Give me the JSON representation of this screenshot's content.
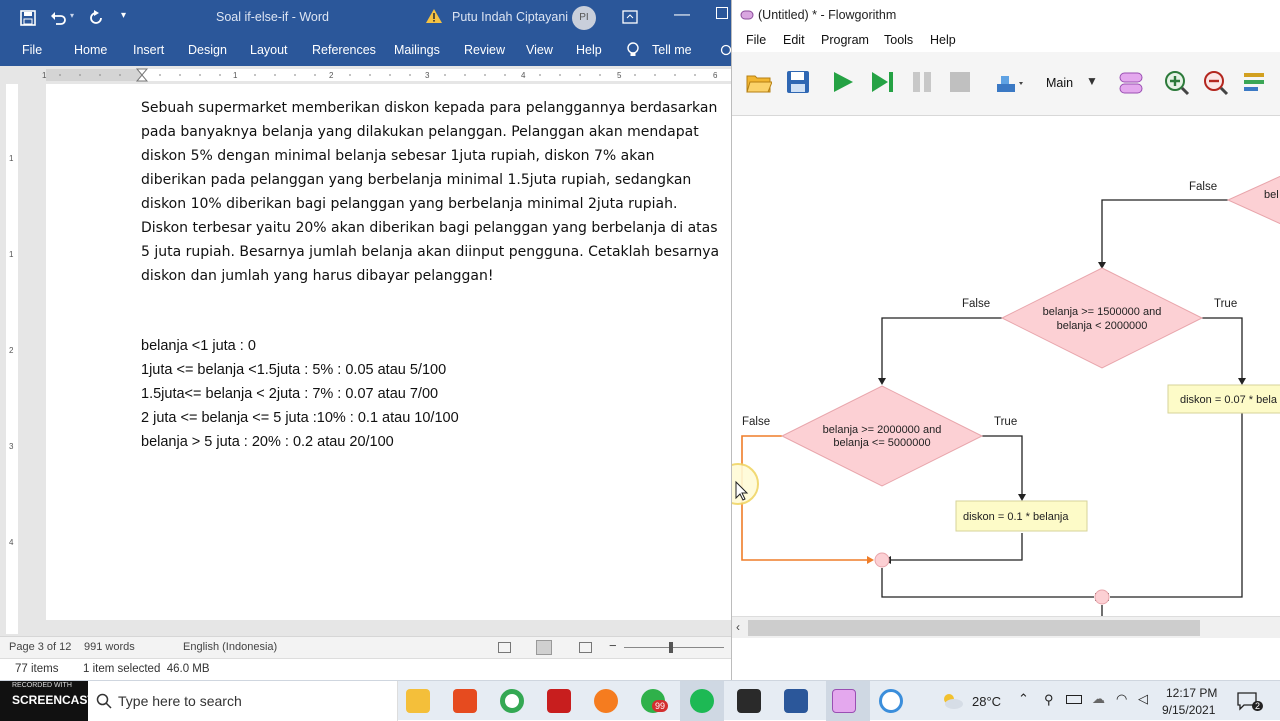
{
  "word": {
    "title": "Soal if-else-if  -  Word",
    "user": "Putu Indah Ciptayani",
    "user_initials": "PI",
    "tabs": [
      "File",
      "Home",
      "Insert",
      "Design",
      "Layout",
      "References",
      "Mailings",
      "Review",
      "View",
      "Help"
    ],
    "tell_me": "Tell me",
    "paragraph": [
      "Sebuah supermarket memberikan diskon kepada para pelanggannya berdasarkan",
      "pada banyaknya belanja yang dilakukan pelanggan. Pelanggan akan mendapat",
      "diskon 5% dengan minimal belanja sebesar 1juta rupiah, diskon 7% akan",
      "diberikan pada pelanggan yang berbelanja minimal 1.5juta rupiah, sedangkan",
      "diskon 10% diberikan bagi pelanggan yang berbelanja minimal 2juta rupiah.",
      "Diskon terbesar yaitu 20% akan diberikan bagi pelanggan yang berbelanja di atas",
      "5 juta rupiah. Besarnya jumlah belanja akan diinput pengguna. Cetaklah besarnya",
      "diskon dan jumlah yang harus dibayar pelanggan!"
    ],
    "rules": [
      "belanja <1 juta : 0",
      "1juta <= belanja <1.5juta : 5% : 0.05 atau 5/100",
      "1.5juta<= belanja < 2juta : 7% : 0.07 atau 7/00",
      "2 juta <= belanja <= 5 juta :10% : 0.1 atau 10/100",
      "belanja > 5 juta : 20% : 0.2 atau 20/100"
    ],
    "status": {
      "page": "Page 3 of 12",
      "words": "991 words",
      "language": "English (Indonesia)"
    }
  },
  "explorer": {
    "items": "77 items",
    "selected": "1 item selected  46.0 MB"
  },
  "flowgorithm": {
    "title": "(Untitled) * - Flowgorithm",
    "menu": [
      "File",
      "Edit",
      "Program",
      "Tools",
      "Help"
    ],
    "function_select": "Main",
    "diagram": {
      "top_partial_label": "bel",
      "top_false": "False",
      "d1_line1": "belanja >= 1500000 and",
      "d1_line2": "belanja < 2000000",
      "d1_false": "False",
      "d1_true": "True",
      "assign_07": "diskon = 0.07 * bela",
      "d2_line1": "belanja >= 2000000 and",
      "d2_line2": "belanja <= 5000000",
      "d2_false": "False",
      "d2_true": "True",
      "assign_01": "diskon = 0.1 * belanja"
    }
  },
  "taskbar": {
    "recorded_with": "RECORDED WITH",
    "screencast": "SCREENCAST",
    "search_placeholder": "Type here to search",
    "temperature": "28°C",
    "time": "12:17 PM",
    "date": "9/15/2021",
    "chrome_badge": "99",
    "notif_count": "2"
  }
}
